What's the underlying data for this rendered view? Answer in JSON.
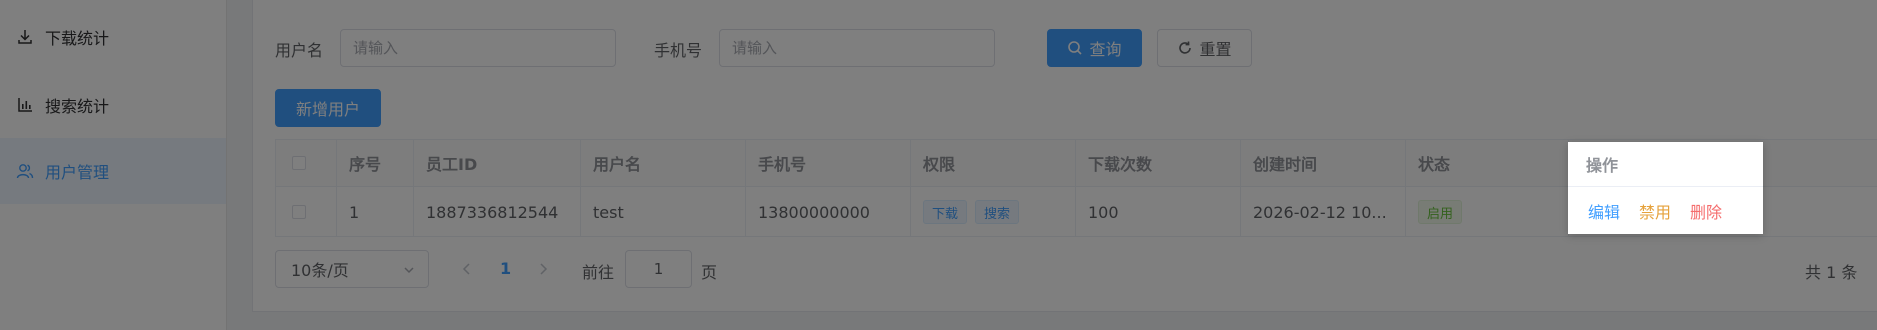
{
  "sidebar": {
    "items": [
      {
        "label": "下载统计",
        "icon": "download-icon"
      },
      {
        "label": "搜索统计",
        "icon": "bar-chart-icon"
      },
      {
        "label": "用户管理",
        "icon": "users-icon",
        "active": true
      }
    ]
  },
  "search": {
    "username_label": "用户名",
    "username_placeholder": "请输入",
    "phone_label": "手机号",
    "phone_placeholder": "请输入",
    "query_button": "查询",
    "reset_button": "重置"
  },
  "add_user_button": "新增用户",
  "table": {
    "headers": {
      "index": "序号",
      "employee_id": "员工ID",
      "username": "用户名",
      "phone": "手机号",
      "permissions": "权限",
      "download_count": "下载次数",
      "created_at": "创建时间",
      "status": "状态",
      "actions": "操作"
    },
    "rows": [
      {
        "index": "1",
        "employee_id": "1887336812544",
        "username": "test",
        "phone": "13800000000",
        "permissions": [
          "下载",
          "搜索"
        ],
        "download_count": "100",
        "created_at": "2026-02-12 10...",
        "status": "启用",
        "actions": {
          "edit": "编辑",
          "disable": "禁用",
          "delete": "删除"
        }
      }
    ]
  },
  "pagination": {
    "page_size": "10条/页",
    "current_page": "1",
    "goto_prefix": "前往",
    "goto_value": "1",
    "goto_suffix": "页",
    "total": "共 1 条"
  },
  "colors": {
    "primary": "#409eff",
    "warning": "#e6a23c",
    "danger": "#f56c6c",
    "success": "#67c23a"
  }
}
